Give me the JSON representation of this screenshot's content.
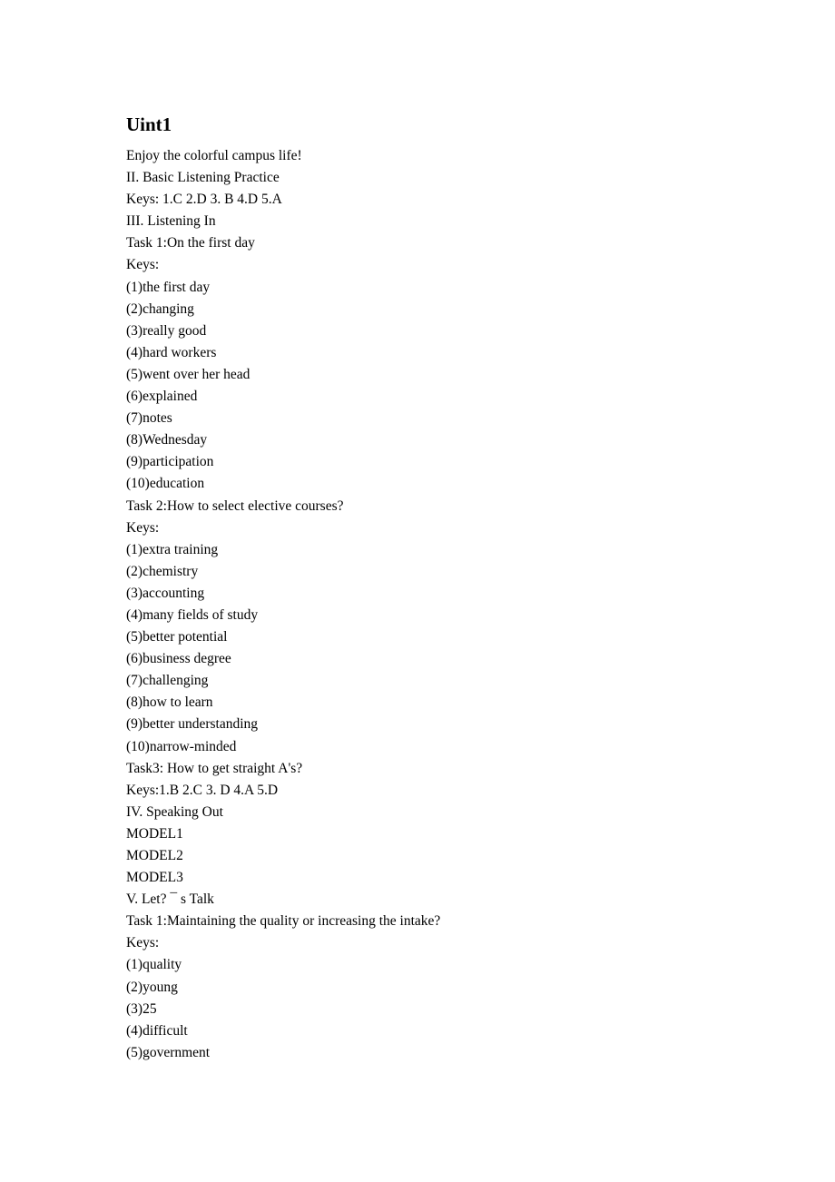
{
  "document": {
    "title": "Uint1",
    "lines": [
      "Enjoy the colorful campus life!",
      "II. Basic Listening Practice",
      "Keys: 1.C 2.D 3. B 4.D 5.A",
      "III. Listening In",
      "Task 1:On the first day",
      "Keys:",
      "(1)the first day",
      "(2)changing",
      "(3)really good",
      "(4)hard workers",
      "(5)went over her head",
      "(6)explained",
      "(7)notes",
      "(8)Wednesday",
      "(9)participation",
      "(10)education",
      "Task 2:How to select elective courses?",
      "Keys:",
      "(1)extra training",
      "(2)chemistry",
      "(3)accounting",
      "(4)many fields of study",
      "(5)better potential",
      "(6)business degree",
      "(7)challenging",
      "(8)how to learn",
      "(9)better understanding",
      "(10)narrow-minded",
      "Task3: How to get straight A's?",
      "Keys:1.B 2.C 3. D 4.A 5.D",
      "IV. Speaking Out",
      "MODEL1",
      "MODEL2",
      "MODEL3",
      "V. Let? ¯ s Talk",
      "Task 1:Maintaining the quality or increasing the intake?",
      "Keys:",
      "(1)quality",
      "(2)young",
      "(3)25",
      "(4)difficult",
      "(5)government"
    ]
  }
}
